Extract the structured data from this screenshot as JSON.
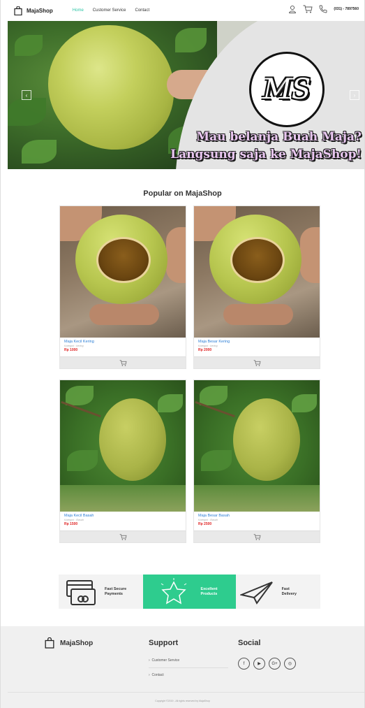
{
  "nav": {
    "brand": "MajaShop",
    "links": [
      "Home",
      "Customer Service",
      "Contact"
    ],
    "phone": "(031) - 7897560"
  },
  "hero": {
    "logo_text": "MS",
    "tagline_1": "Mau belanja Buah Maja?",
    "tagline_2": "Langsung saja ke MajaShop!",
    "prev_label": "‹",
    "next_label": "›"
  },
  "popular": {
    "title": "Popular on MajaShop",
    "products": [
      {
        "name": "Maja Kecil Kering",
        "category": "Kategori : kering",
        "price": "Rp 1000"
      },
      {
        "name": "Maja Besar Kering",
        "category": "Kategori : kering",
        "price": "Rp 2000"
      },
      {
        "name": "Maja Kecil Basah",
        "category": "Kategori : Basah",
        "price": "Rp 1500"
      },
      {
        "name": "Maja Besar Basah",
        "category": "Kategori : Basah",
        "price": "Rp 2500"
      }
    ]
  },
  "features": [
    {
      "line1": "Fast Secure",
      "line2": "Payments",
      "icon": "credit-card-icon"
    },
    {
      "line1": "Excellent",
      "line2": "Products",
      "icon": "star-icon"
    },
    {
      "line1": "Fast",
      "line2": "Delivery",
      "icon": "paper-plane-icon"
    }
  ],
  "footer": {
    "brand": "MajaShop",
    "support_heading": "Support",
    "support_links": [
      "Customer Service",
      "Contact"
    ],
    "social_heading": "Social",
    "social_icons": [
      "f",
      "▶",
      "G+",
      "◎"
    ],
    "copyright": "Copyright ©2019 - All rights reserved by MajaShop"
  },
  "colors": {
    "accent": "#2bc4a5",
    "feature_green": "#2ecc8e",
    "price_red": "#e02626",
    "link_blue": "#2d7fd6"
  }
}
